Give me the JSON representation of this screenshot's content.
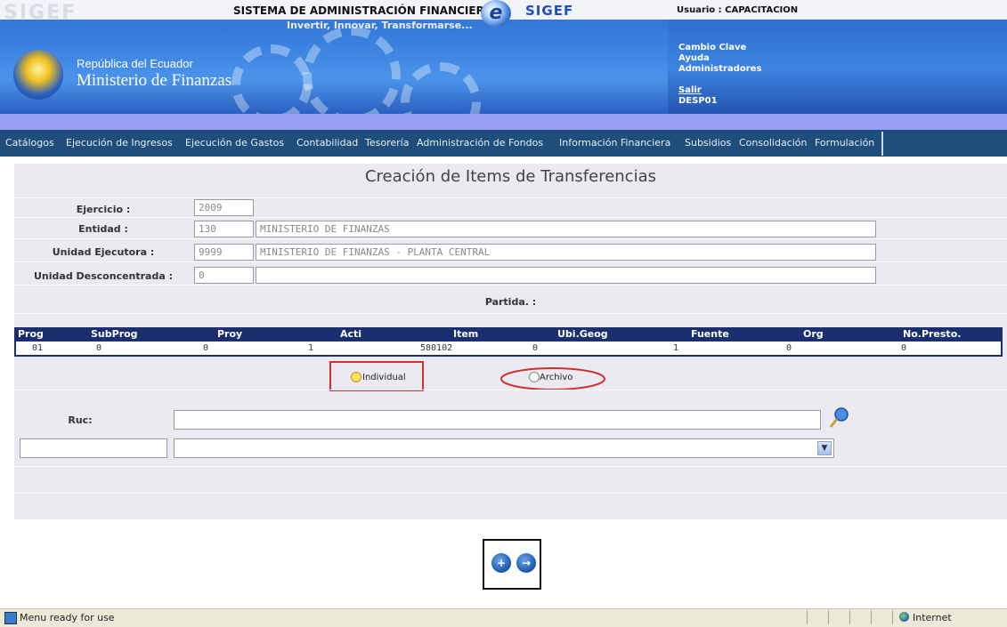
{
  "header": {
    "watermark": "SIGEF",
    "system_title": "SISTEMA DE ADMINISTRACIÓN FINANCIERA",
    "logo_letter": "e",
    "logo_text": "SIGEF",
    "slogan": "Invertir, Innovar, Transformarse...",
    "republica": "República del Ecuador",
    "ministerio": "Ministerio de Finanzas",
    "usuario": "Usuario : CAPACITACION",
    "links": [
      "Cambio Clave",
      "Ayuda",
      "Administradores"
    ],
    "salir": "Salir",
    "session_code": "DESP01"
  },
  "menu": [
    "Catálogos",
    "Ejecución de Ingresos",
    "Ejecución de Gastos",
    "Contabilidad",
    "Tesorería",
    "Administración de Fondos",
    "Información Financiera",
    "Subsidios",
    "Consolidación",
    "Formulación"
  ],
  "form": {
    "title": "Creación de Items de Transferencias",
    "ejercicio_label": "Ejercicio :",
    "ejercicio_value": "2009",
    "entidad_label": "Entidad :",
    "entidad_code": "130",
    "entidad_name": "MINISTERIO DE FINANZAS",
    "unidad_ejecutora_label": "Unidad Ejecutora :",
    "unidad_ejecutora_code": "9999",
    "unidad_ejecutora_name": "MINISTERIO DE FINANZAS - PLANTA CENTRAL",
    "unidad_desc_label": "Unidad Desconcentrada :",
    "unidad_desc_code": "0",
    "unidad_desc_name": "",
    "partida_label": "Partida. :"
  },
  "table": {
    "headers": [
      "Prog",
      "SubProg",
      "Proy",
      "Acti",
      "Item",
      "Ubi.Geog",
      "Fuente",
      "Org",
      "No.Presto."
    ],
    "row": [
      "01",
      "0",
      "0",
      "1",
      "580102",
      "0",
      "1",
      "0",
      "0"
    ]
  },
  "options": {
    "individual": "Individual",
    "archivo": "Archivo"
  },
  "ruc": {
    "label": "Ruc:",
    "value": ""
  },
  "buttons": {
    "new": "+",
    "exit": "→"
  },
  "status": {
    "text": "Menu ready for use",
    "zone": "Internet"
  }
}
